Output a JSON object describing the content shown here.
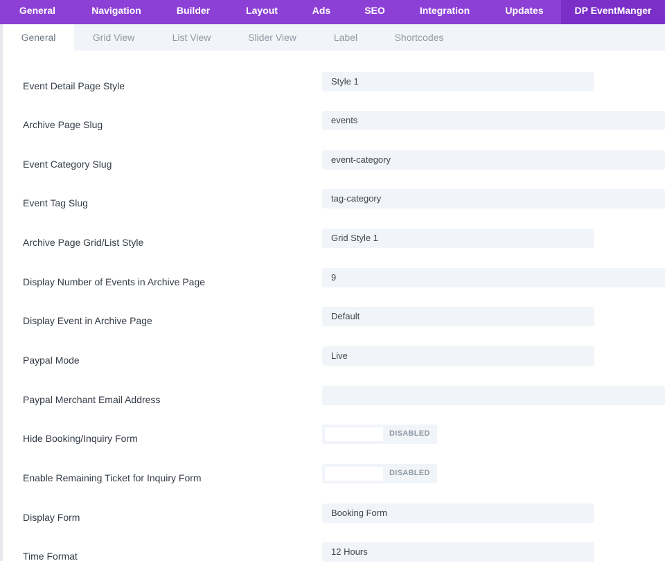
{
  "top_tabs": [
    {
      "label": "General"
    },
    {
      "label": "Navigation"
    },
    {
      "label": "Builder"
    },
    {
      "label": "Layout"
    },
    {
      "label": "Ads"
    },
    {
      "label": "SEO"
    },
    {
      "label": "Integration"
    },
    {
      "label": "Updates"
    },
    {
      "label": "DP EventManger"
    }
  ],
  "active_top_tab": "DP EventManger",
  "sub_tabs": [
    {
      "label": "General"
    },
    {
      "label": "Grid View"
    },
    {
      "label": "List View"
    },
    {
      "label": "Slider View"
    },
    {
      "label": "Label"
    },
    {
      "label": "Shortcodes"
    }
  ],
  "active_sub_tab": "General",
  "settings": [
    {
      "label": "Event Detail Page Style",
      "type": "select",
      "value": "Style 1"
    },
    {
      "label": "Archive Page Slug",
      "type": "text",
      "value": "events"
    },
    {
      "label": "Event Category Slug",
      "type": "text",
      "value": "event-category"
    },
    {
      "label": "Event Tag Slug",
      "type": "text",
      "value": "tag-category"
    },
    {
      "label": "Archive Page Grid/List Style",
      "type": "select",
      "value": "Grid Style 1"
    },
    {
      "label": "Display Number of Events in Archive Page",
      "type": "text",
      "value": "9"
    },
    {
      "label": "Display Event in Archive Page",
      "type": "select",
      "value": "Default"
    },
    {
      "label": "Paypal Mode",
      "type": "select",
      "value": "Live"
    },
    {
      "label": "Paypal Merchant Email Address",
      "type": "text",
      "value": ""
    },
    {
      "label": "Hide Booking/Inquiry Form",
      "type": "toggle",
      "value": "DISABLED"
    },
    {
      "label": "Enable Remaining Ticket for Inquiry Form",
      "type": "toggle",
      "value": "DISABLED"
    },
    {
      "label": "Display Form",
      "type": "select",
      "value": "Booking Form"
    },
    {
      "label": "Time Format",
      "type": "select",
      "value": "12 Hours"
    }
  ]
}
